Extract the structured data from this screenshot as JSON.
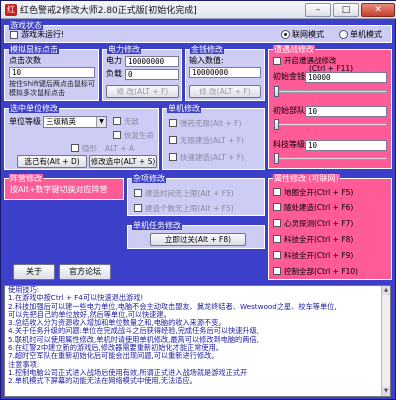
{
  "window": {
    "title": "红色警戒2修改大师2.80正式版[初始化完成]",
    "minimize": "–",
    "maximize": "□",
    "close": "✕"
  },
  "status": {
    "title": "游戏状态",
    "message": "游戏未运行!",
    "mode_online": "联网模式",
    "mode_single": "单机模式",
    "selected_mode": "online"
  },
  "mouse": {
    "title": "模拟鼠标点击",
    "count_label": "点击次数",
    "count_value": "10",
    "hint": "按住Shift键后两点击鼠标可模拟多次鼠标点击"
  },
  "power": {
    "title": "电力修改",
    "power_label": "电力",
    "power_value": "10000000",
    "load_label": "负载",
    "load_value": "0",
    "button": "修 改(ALT + F)"
  },
  "money": {
    "title": "金钱修改",
    "input_label": "输入数值:",
    "input_value": "10000000",
    "button": "修 改(ALT + F)"
  },
  "special": {
    "title": "遭遇战修改",
    "enable_label": "开启遭遇战修改",
    "hotkey": "(Ctrl + F11)",
    "init_money_label": "初始金钱",
    "init_money_value": "10000",
    "init_units_label": "初始部队",
    "init_units_value": "10",
    "tech_label": "科技等级",
    "tech_value": "10"
  },
  "unit": {
    "title": "选中单位修改",
    "level_label": "单位等级",
    "level_value": "三级精英",
    "invincible_label": "无敌",
    "hp_label": "恢复生命",
    "cloak_label": "隐形",
    "cloak_hotkey": "ALT + A",
    "btn_all": "选己有(Alt + D)",
    "btn_selected": "修改选中(ALT + S)"
  },
  "unit_mod": {
    "title": "单机修改",
    "items": [
      "弹药无限(Alt + F)",
      "无限建造(ALT + F)",
      "快速建造(ALT + F)"
    ]
  },
  "enemy": {
    "title": "阵营修改",
    "hint": "按Alt+数字键切换对应阵营"
  },
  "misc": {
    "title": "杂项修改",
    "items": [
      "建造时间无上限(Alt + F5)",
      "建造个数无上限(Alt + F5)"
    ]
  },
  "mission": {
    "title": "单机任务修改",
    "button": "立即过关(Alt + F8)"
  },
  "attributes": {
    "title": "属性修改 (可联网)",
    "items": [
      "地图全开(Ctrl + F5)",
      "随处建造(Ctrl + F6)",
      "心灵探测(Ctrl + F7)",
      "科技全开(Ctrl + F8)",
      "科技全开(Ctrl + F9)",
      "控制全部(Ctrl + F10)"
    ]
  },
  "footer": {
    "about": "关于",
    "forum": "官方论坛"
  },
  "usage": {
    "lines": [
      "使用技巧:",
      "1.在游戏中按Ctrl + F4可以快速退出游戏!",
      "2.科技加强后可以建一些电力单位,电脑不会主动攻击盟友、冀龙终结者、Westwood之星、校车等单位,",
      "  可以先把自己的单位放好,然后等单位,可以快速建。",
      "3.总结收入分为资源收入增加和单位数量之和,电脑的收入来源不变。",
      "4.关于任务升级的问题:单位在完成战斗之后获得经验,完成任务后可以快速升级,",
      "5.联机时可以使用属性修改,单机时请使用单机修改,最高可以修改到电脑的两倍,",
      "6.在红警2中建立新的游戏后,修改器需要重新初始化才能正常使用。",
      "7.超时空军队在重新初始化后可能会出现问题,可以重新进行修改。",
      "注意事项:",
      "1.控制电脑公司正式进入战场后使用有效,所谓正式进入战场就是游戏正式开",
      "2.单机模式下屏幕的功能无法在网络模式中使用,无法适应。"
    ]
  }
}
